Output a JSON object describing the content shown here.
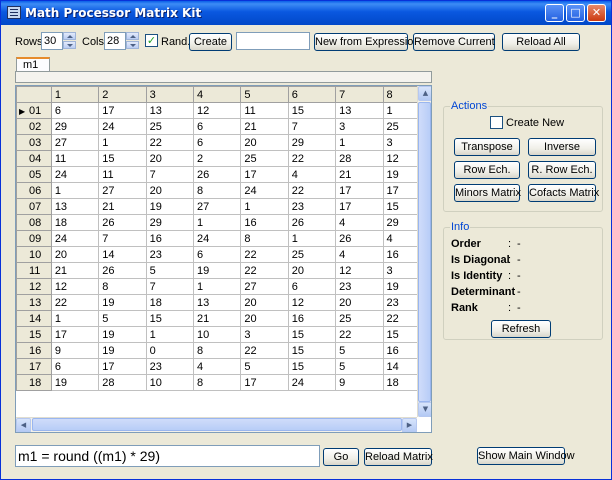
{
  "window": {
    "title": "Math Processor Matrix Kit",
    "min_glyph": "_",
    "max_glyph": "□",
    "close_glyph": "✕"
  },
  "toolbar": {
    "rows_label": "Rows",
    "rows_value": "30",
    "cols_label": "Cols",
    "cols_value": "28",
    "rand_label": "Rand.",
    "rand_checked": true,
    "create_label": "Create",
    "name_value": "",
    "new_from_expr_label": "New from Expression",
    "remove_current_label": "Remove Current",
    "reload_all_label": "Reload All"
  },
  "tabs": [
    {
      "label": "m1",
      "selected": true
    }
  ],
  "grid": {
    "col_headers": [
      "1",
      "2",
      "3",
      "4",
      "5",
      "6",
      "7",
      "8"
    ],
    "row_headers": [
      "01",
      "02",
      "03",
      "04",
      "05",
      "06",
      "07",
      "08",
      "09",
      "10",
      "11",
      "12",
      "13",
      "14",
      "15",
      "16",
      "17",
      "18"
    ],
    "current_row": "01",
    "rows": [
      [
        "6",
        "17",
        "13",
        "12",
        "11",
        "15",
        "13",
        "1"
      ],
      [
        "29",
        "24",
        "25",
        "6",
        "21",
        "7",
        "3",
        "25"
      ],
      [
        "27",
        "1",
        "22",
        "6",
        "20",
        "29",
        "1",
        "3"
      ],
      [
        "11",
        "15",
        "20",
        "2",
        "25",
        "22",
        "28",
        "12"
      ],
      [
        "24",
        "11",
        "7",
        "26",
        "17",
        "4",
        "21",
        "19"
      ],
      [
        "1",
        "27",
        "20",
        "8",
        "24",
        "22",
        "17",
        "17"
      ],
      [
        "13",
        "21",
        "19",
        "27",
        "1",
        "23",
        "17",
        "15"
      ],
      [
        "18",
        "26",
        "29",
        "1",
        "16",
        "26",
        "4",
        "29"
      ],
      [
        "24",
        "7",
        "16",
        "24",
        "8",
        "1",
        "26",
        "4"
      ],
      [
        "20",
        "14",
        "23",
        "6",
        "22",
        "25",
        "4",
        "16"
      ],
      [
        "21",
        "26",
        "5",
        "19",
        "22",
        "20",
        "12",
        "3"
      ],
      [
        "12",
        "8",
        "7",
        "1",
        "27",
        "6",
        "23",
        "19"
      ],
      [
        "22",
        "19",
        "18",
        "13",
        "20",
        "12",
        "20",
        "23"
      ],
      [
        "1",
        "5",
        "15",
        "21",
        "20",
        "16",
        "25",
        "22"
      ],
      [
        "17",
        "19",
        "1",
        "10",
        "3",
        "15",
        "22",
        "15"
      ],
      [
        "9",
        "19",
        "0",
        "8",
        "22",
        "15",
        "5",
        "16"
      ],
      [
        "6",
        "17",
        "23",
        "4",
        "5",
        "15",
        "5",
        "14"
      ],
      [
        "19",
        "28",
        "10",
        "8",
        "17",
        "24",
        "9",
        "18"
      ]
    ]
  },
  "actions": {
    "title": "Actions",
    "create_new_label": "Create New",
    "create_new_checked": false,
    "transpose_label": "Transpose",
    "inverse_label": "Inverse",
    "row_ech_label": "Row Ech.",
    "r_row_ech_label": "R. Row Ech.",
    "minors_label": "Minors Matrix",
    "cofacts_label": "Cofacts Matrix"
  },
  "info": {
    "title": "Info",
    "separator": ":",
    "items": [
      {
        "label": "Order",
        "value": "-"
      },
      {
        "label": "Is Diagonal",
        "value": "-"
      },
      {
        "label": "Is Identity",
        "value": "-"
      },
      {
        "label": "Determinant",
        "value": "-"
      },
      {
        "label": "Rank",
        "value": "-"
      }
    ],
    "refresh_label": "Refresh"
  },
  "bottom": {
    "expression": "m1 = round ((m1) * 29)",
    "go_label": "Go",
    "reload_matrix_label": "Reload Matrix",
    "show_main_label": "Show Main Window"
  },
  "icons": {
    "current_row_glyph": "▶",
    "checkmark_glyph": "✓",
    "scroll_up_glyph": "▲",
    "scroll_down_glyph": "▼",
    "scroll_left_glyph": "◀",
    "scroll_right_glyph": "▶"
  }
}
